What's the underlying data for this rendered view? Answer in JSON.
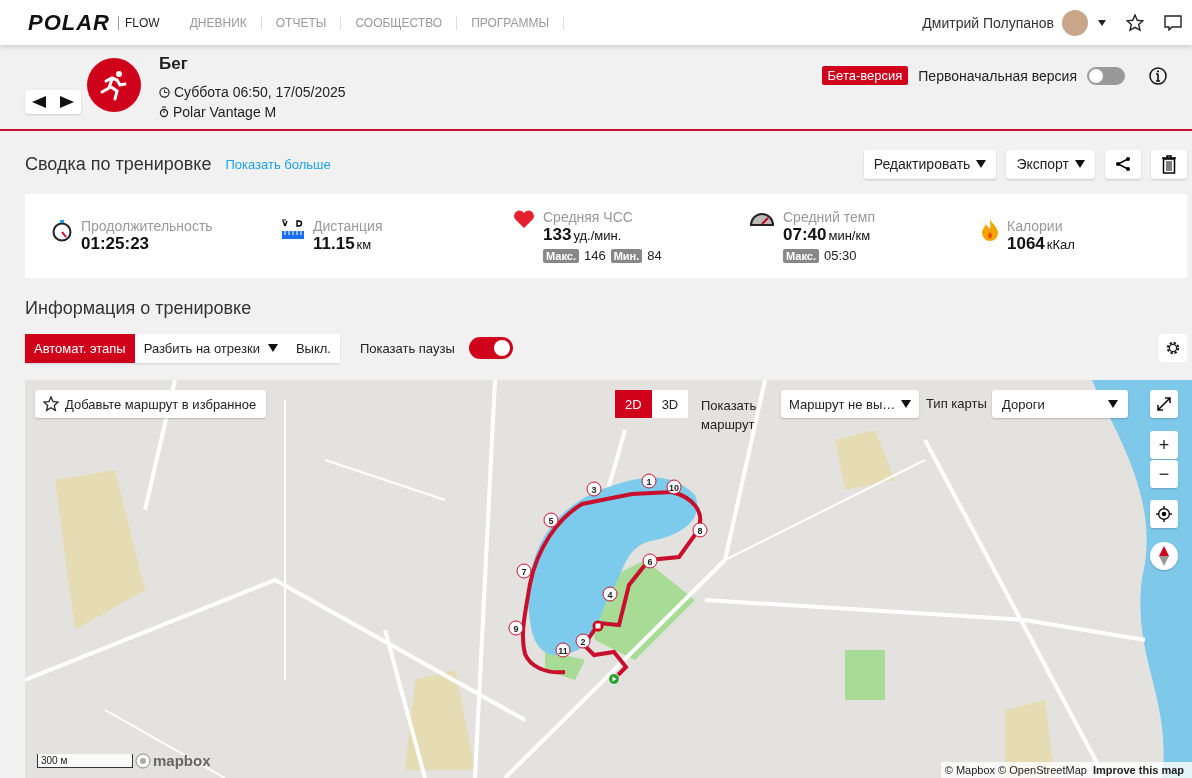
{
  "topbar": {
    "brand": "POLAR",
    "product": "FLOW",
    "nav": [
      {
        "label": "ДНЕВНИК"
      },
      {
        "label": "ОТЧЕТЫ"
      },
      {
        "label": "СООБЩЕСТВО"
      },
      {
        "label": "ПРОГРАММЫ"
      }
    ],
    "user": "Дмитрий Полупанов"
  },
  "activity": {
    "sport": "Бег",
    "datetime": "Суббота 06:50, 17/05/2025",
    "device": "Polar Vantage M",
    "beta_badge": "Бета-версия",
    "legacy_label": "Первоначальная версия",
    "legacy_on": false
  },
  "summary": {
    "title": "Сводка по тренировке",
    "more_link": "Показать больше",
    "buttons": [
      {
        "kind": "dropdown",
        "label": "Редактировать"
      },
      {
        "kind": "dropdown",
        "label": "Экспорт"
      },
      {
        "kind": "share"
      },
      {
        "kind": "delete"
      }
    ],
    "stats": [
      {
        "kind": "duration",
        "label": "Продолжительность",
        "value": "01:25:23"
      },
      {
        "kind": "distance",
        "label": "Дистанция",
        "value": "11.15",
        "unit": "км"
      },
      {
        "kind": "heart",
        "label": "Средняя ЧСС",
        "value": "133",
        "unit": "уд./мин.",
        "extras": [
          {
            "tag": "Макс.",
            "value": "146"
          },
          {
            "tag": "Мин.",
            "value": "84"
          }
        ]
      },
      {
        "kind": "pace",
        "label": "Средний темп",
        "value": "07:40",
        "unit": "мин/км",
        "extras": [
          {
            "tag": "Макс.",
            "value": "05:30"
          }
        ]
      },
      {
        "kind": "calories",
        "label": "Калории",
        "value": "1064",
        "unit": "кКал"
      }
    ]
  },
  "info": {
    "title": "Информация о тренировке",
    "segments": [
      {
        "label": "Автомат. этапы",
        "selected": true,
        "dropdown": false
      },
      {
        "label": "Разбить на отрезки",
        "selected": false,
        "dropdown": true
      },
      {
        "label": "Выкл.",
        "selected": false,
        "dropdown": false
      }
    ],
    "pauses_label": "Показать паузы",
    "pauses_on": true
  },
  "map": {
    "favorite_button": "Добавьте маршрут в избранное",
    "view_modes": [
      {
        "label": "2D",
        "selected": true
      },
      {
        "label": "3D",
        "selected": false
      }
    ],
    "show_route_label": "Показать маршрут",
    "route_select": "Маршрут не вы…",
    "map_type_label": "Тип карты",
    "map_type_select": "Дороги",
    "zoom_in": "+",
    "zoom_out": "−",
    "route_markers": [
      "1",
      "10",
      "3",
      "5",
      "8",
      "6",
      "7",
      "4",
      "9",
      "2",
      "11"
    ],
    "scale": "300 м",
    "mapbox_logo": "mapbox",
    "attribution": "© Mapbox © OpenStreetMap",
    "improve_link": "Improve this map"
  }
}
